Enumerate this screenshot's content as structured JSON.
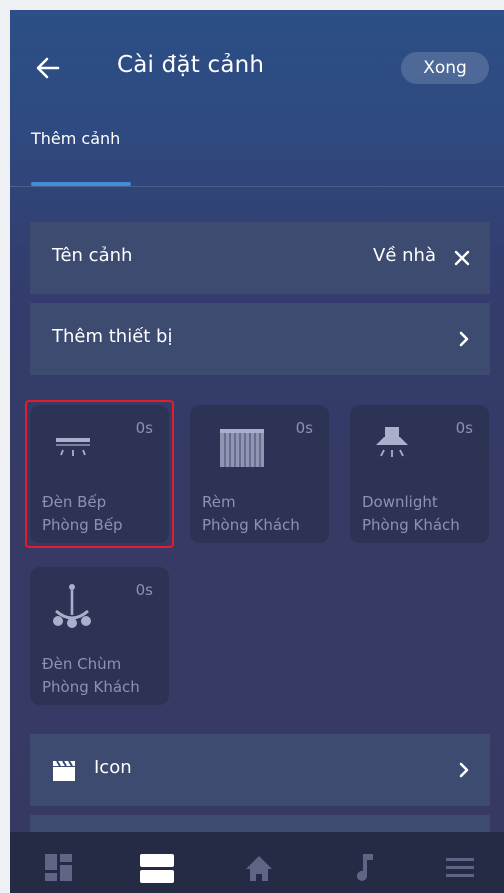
{
  "header": {
    "title": "Cài đặt cảnh",
    "done_label": "Xong"
  },
  "tabs": [
    {
      "label": "Thêm cảnh",
      "active": true
    }
  ],
  "scene_name_row": {
    "label": "Tên cảnh",
    "value": "Về nhà"
  },
  "add_device_row": {
    "label": "Thêm thiết bị"
  },
  "devices": [
    {
      "name": "Đèn Bếp",
      "room": "Phòng Bếp",
      "delay": "0s",
      "icon": "ceiling-light-icon",
      "selected": true
    },
    {
      "name": "Rèm",
      "room": "Phòng Khách",
      "delay": "0s",
      "icon": "curtain-icon",
      "selected": false
    },
    {
      "name": "Downlight",
      "room": "Phòng Khách",
      "delay": "0s",
      "icon": "downlight-icon",
      "selected": false
    },
    {
      "name": "Đèn Chùm",
      "room": "Phòng Khách",
      "delay": "0s",
      "icon": "chandelier-icon",
      "selected": false
    }
  ],
  "icon_row": {
    "label": "Icon",
    "icon": "clapperboard-icon"
  },
  "bottom_nav": [
    {
      "icon": "dashboard-icon",
      "active": false
    },
    {
      "icon": "scenes-icon",
      "active": true
    },
    {
      "icon": "home-icon",
      "active": false
    },
    {
      "icon": "music-icon",
      "active": false
    },
    {
      "icon": "menu-icon",
      "active": false
    }
  ],
  "colors": {
    "accent": "#3e8ed8",
    "selection_border": "#e51c2a",
    "row_background": "#3c4b6f",
    "card_background": "#2d3354",
    "muted_text": "#8d92b0"
  }
}
